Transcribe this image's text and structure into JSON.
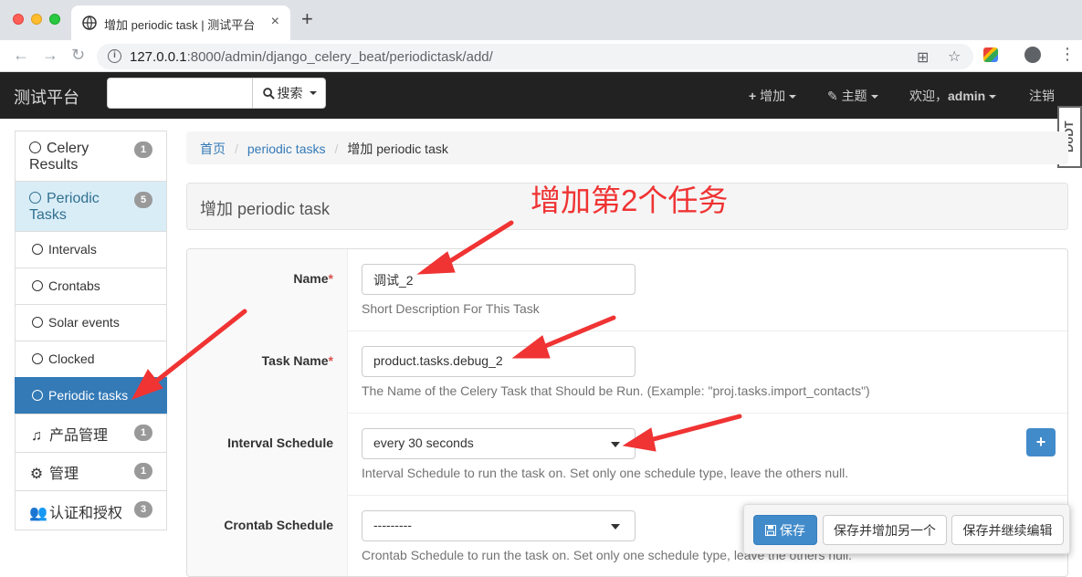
{
  "browser": {
    "tab_title": "增加 periodic task | 测试平台",
    "url_host": "127.0.0.1",
    "url_rest": ":8000/admin/django_celery_beat/periodictask/add/"
  },
  "navbar": {
    "brand": "测试平台",
    "search_label": "搜索",
    "add_label": "增加",
    "theme_label": "主题",
    "welcome_prefix": "欢迎，",
    "user": "admin",
    "logout": "注销"
  },
  "sidebar": {
    "items": [
      {
        "label": "Celery Results",
        "badge": "1"
      },
      {
        "label": "Periodic Tasks",
        "badge": "5"
      },
      {
        "label": "Intervals"
      },
      {
        "label": "Crontabs"
      },
      {
        "label": "Solar events"
      },
      {
        "label": "Clocked"
      },
      {
        "label": "Periodic tasks"
      },
      {
        "label": "产品管理",
        "badge": "1"
      },
      {
        "label": "管理",
        "badge": "1"
      },
      {
        "label": "认证和授权",
        "badge": "3"
      }
    ]
  },
  "breadcrumb": {
    "home": "首页",
    "section": "periodic tasks",
    "current": "增加 periodic task"
  },
  "page_title": "增加 periodic task",
  "form": {
    "name": {
      "label": "Name",
      "required_mark": "*",
      "value": "调试_2",
      "help": "Short Description For This Task"
    },
    "task_name": {
      "label": "Task Name",
      "required_mark": "*",
      "value": "product.tasks.debug_2",
      "help": "The Name of the Celery Task that Should be Run. (Example: \"proj.tasks.import_contacts\")"
    },
    "interval": {
      "label": "Interval Schedule",
      "value": "every 30 seconds",
      "help": "Interval Schedule to run the task on. Set only one schedule type, leave the others null."
    },
    "crontab": {
      "label": "Crontab Schedule",
      "value": "---------",
      "help": "Crontab Schedule to run the task on. Set only one schedule type, leave the others null."
    },
    "add_button": "+"
  },
  "savebar": {
    "save": "保存",
    "save_add": "保存并增加另一个",
    "save_continue": "保存并继续编辑"
  },
  "annotation": {
    "text": "增加第2个任务",
    "color": "#f03333"
  },
  "watermark": "DoDT"
}
